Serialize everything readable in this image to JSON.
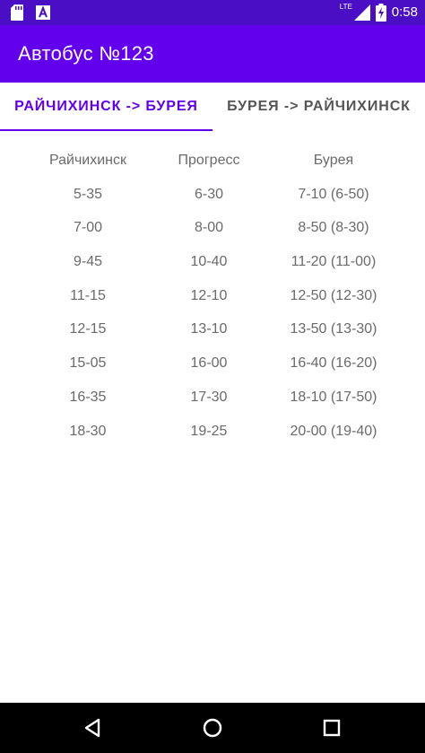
{
  "status_bar": {
    "time": "0:58",
    "network": "LTE",
    "icons": [
      "sd-card-icon",
      "text-a-icon",
      "signal-icon",
      "battery-charging-icon"
    ]
  },
  "app_bar": {
    "title": "Автобус №123"
  },
  "tabs": [
    {
      "label": "РАЙЧИХИНСК -> БУРЕЯ",
      "selected": true
    },
    {
      "label": "БУРЕЯ -> РАЙЧИХИНСК",
      "selected": false
    }
  ],
  "schedule": {
    "headers": [
      "Райчихинск",
      "Прогресс",
      "Бурея"
    ],
    "rows": [
      [
        "5-35",
        "6-30",
        "7-10 (6-50)"
      ],
      [
        "7-00",
        "8-00",
        "8-50 (8-30)"
      ],
      [
        "9-45",
        "10-40",
        "11-20 (11-00)"
      ],
      [
        "11-15",
        "12-10",
        "12-50 (12-30)"
      ],
      [
        "12-15",
        "13-10",
        "13-50 (13-30)"
      ],
      [
        "15-05",
        "16-00",
        "16-40 (16-20)"
      ],
      [
        "16-35",
        "17-30",
        "18-10 (17-50)"
      ],
      [
        "18-30",
        "19-25",
        "20-00 (19-40)"
      ]
    ]
  },
  "nav_bar": {
    "icons": [
      "back-icon",
      "home-icon",
      "recents-icon"
    ]
  },
  "colors": {
    "status_bar": "#4a0fc4",
    "app_bar": "#6200ee",
    "accent": "#6200ee",
    "text_secondary": "#6a6a6a",
    "nav_bar": "#000000"
  }
}
